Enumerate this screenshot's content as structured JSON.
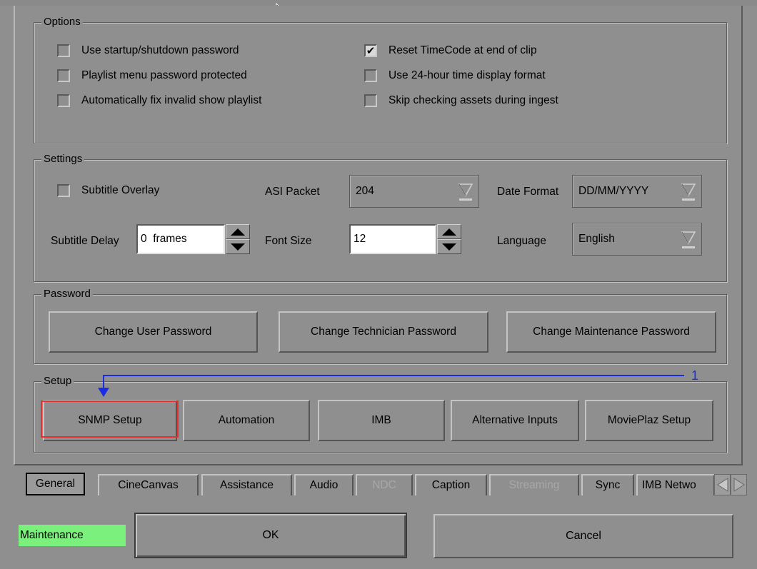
{
  "options": {
    "title": "Options",
    "checkboxes": [
      {
        "label": "Use startup/shutdown password",
        "checked": false
      },
      {
        "label": "Reset TimeCode at end of clip",
        "checked": true
      },
      {
        "label": "Playlist menu password protected",
        "checked": false
      },
      {
        "label": "Use 24-hour time display format",
        "checked": false
      },
      {
        "label": "Automatically fix invalid show playlist",
        "checked": false
      },
      {
        "label": "Skip checking assets during ingest",
        "checked": false
      }
    ],
    "check_mark": "✔"
  },
  "settings": {
    "title": "Settings",
    "subtitle_overlay": {
      "label": "Subtitle Overlay",
      "checked": false
    },
    "asi_packet": {
      "label": "ASI Packet",
      "value": "204"
    },
    "date_format": {
      "label": "Date Format",
      "value": "DD/MM/YYYY"
    },
    "subtitle_delay": {
      "label": "Subtitle Delay",
      "value": "0  frames"
    },
    "font_size": {
      "label": "Font Size",
      "value": "12"
    },
    "language": {
      "label": "Language",
      "value": "English"
    }
  },
  "password": {
    "title": "Password",
    "buttons": [
      "Change User Password",
      "Change Technician Password",
      "Change Maintenance Password"
    ]
  },
  "setup": {
    "title": "Setup",
    "buttons": [
      "SNMP Setup",
      "Automation",
      "IMB",
      "Alternative Inputs",
      "MoviePlaz Setup"
    ],
    "annotation_number": "1",
    "highlight_color": "#e53030",
    "annotation_color": "#1a2ee0"
  },
  "tabs": [
    {
      "label": "General",
      "active": true,
      "disabled": false
    },
    {
      "label": "CineCanvas",
      "active": false,
      "disabled": false
    },
    {
      "label": "Assistance",
      "active": false,
      "disabled": false
    },
    {
      "label": "Audio",
      "active": false,
      "disabled": false
    },
    {
      "label": "NDC",
      "active": false,
      "disabled": true
    },
    {
      "label": "Caption",
      "active": false,
      "disabled": false
    },
    {
      "label": "Streaming",
      "active": false,
      "disabled": true
    },
    {
      "label": "Sync",
      "active": false,
      "disabled": false
    },
    {
      "label": "IMB Netwo",
      "active": false,
      "disabled": false
    }
  ],
  "footer": {
    "mode": "Maintenance",
    "mode_color": "#7cf07c",
    "ok_label": "OK",
    "cancel_label": "Cancel"
  },
  "icons": {
    "cursor": "mouse-pointer-icon",
    "dropdown": "triangle-down-icon",
    "spin_up": "triangle-up-icon",
    "spin_down": "triangle-down-icon",
    "tab_left": "triangle-left-icon",
    "tab_right": "triangle-right-icon"
  }
}
